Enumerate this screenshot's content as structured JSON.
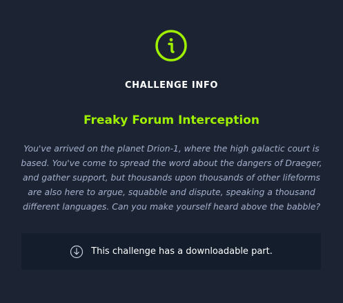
{
  "modal": {
    "icon": "info-circle-icon",
    "heading": "CHALLENGE INFO",
    "title": "Freaky Forum Interception",
    "description": "You've arrived on the planet Drion-1, where the high galactic court is based. You've come to spread the word about the dangers of Draeger, and gather support, but thousands upon thousands of other lifeforms are also here to argue, squabble and dispute, speaking a thousand different languages. Can you make yourself heard above the babble?",
    "download": {
      "icon": "download-circle-icon",
      "text": "This challenge has a downloadable part."
    }
  },
  "colors": {
    "background": "#1c2333",
    "accent": "#9fef00",
    "description_text": "#a4b1cd",
    "download_box": "#141d2b"
  }
}
